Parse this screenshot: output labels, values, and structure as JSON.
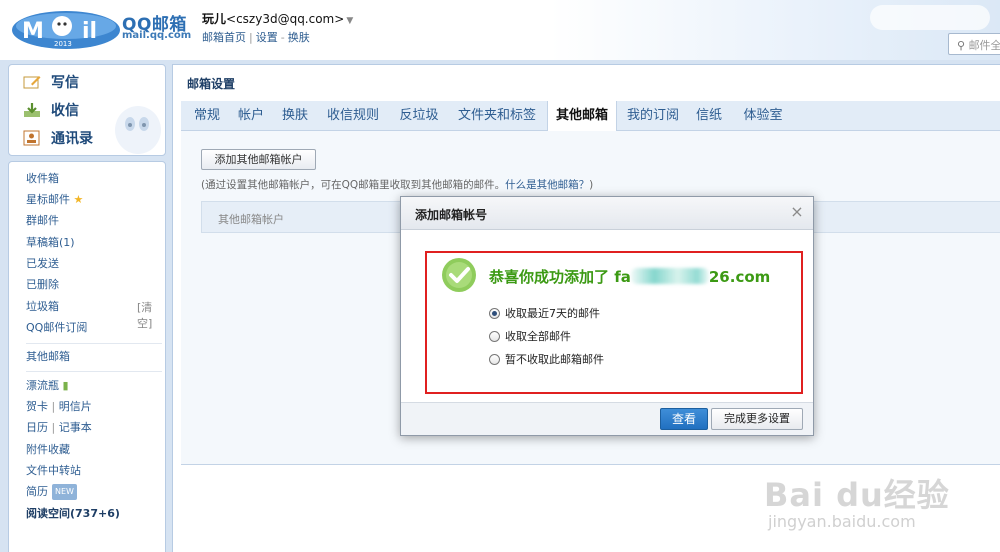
{
  "header": {
    "logo_text": "QQ邮箱",
    "logo_sub": "mail.qq.com",
    "logo_year": "2013",
    "user_nick": "玩儿",
    "user_email": "<cszy3d@qq.com>",
    "user_dropdown": "▼",
    "links": [
      "邮箱首页",
      "设置",
      "换肤"
    ],
    "search_placeholder": "邮件全"
  },
  "sidebar": {
    "main_items": [
      {
        "label": "写信",
        "icon": "compose-icon"
      },
      {
        "label": "收信",
        "icon": "inbox-download-icon"
      },
      {
        "label": "通讯录",
        "icon": "contacts-icon"
      }
    ],
    "folders": [
      {
        "label": "收件箱"
      },
      {
        "label": "星标邮件"
      },
      {
        "label": "群邮件"
      },
      {
        "label": "草稿箱(1)"
      },
      {
        "label": "已发送"
      },
      {
        "label": "已删除"
      },
      {
        "label": "垃圾箱",
        "action": "[清空]"
      },
      {
        "label": "QQ邮件订阅"
      }
    ],
    "other_mailbox": "其他邮箱",
    "extras": [
      {
        "label": "漂流瓶"
      },
      {
        "label": "贺卡",
        "second": "明信片"
      },
      {
        "label": "日历",
        "second": "记事本"
      },
      {
        "label": "附件收藏"
      },
      {
        "label": "文件中转站"
      },
      {
        "label": "简历",
        "badge": "NEW"
      },
      {
        "label": "阅读空间(737+6)"
      }
    ]
  },
  "main": {
    "title": "邮箱设置",
    "tabs": [
      "常规",
      "帐户",
      "换肤",
      "收信规则",
      "反垃圾",
      "文件夹和标签",
      "其他邮箱",
      "我的订阅",
      "信纸",
      "体验室"
    ],
    "active_tab": "其他邮箱",
    "add_button": "添加其他邮箱帐户",
    "description": "(通过设置其他邮箱帐户，可在QQ邮箱里收取到其他邮箱的邮件。",
    "description_link": "什么是其他邮箱？",
    "description_end": ")",
    "list_header": "其他邮箱帐户"
  },
  "dialog": {
    "title": "添加邮箱帐号",
    "close": "×",
    "success_prefix": "恭喜你成功添加了 fa",
    "success_suffix": "26.com",
    "options": [
      {
        "label": "收取最近7天的邮件",
        "checked": true
      },
      {
        "label": "收取全部邮件",
        "checked": false
      },
      {
        "label": "暂不收取此邮箱邮件",
        "checked": false
      }
    ],
    "view_button": "查看",
    "more_button": "完成更多设置"
  },
  "watermark": {
    "text": "Bai du经验",
    "url": "jingyan.baidu.com"
  },
  "colors": {
    "accent": "#2d6fb3",
    "success": "#3c9a14",
    "highlight_border": "#e02020",
    "primary_button": "#2170c0"
  }
}
